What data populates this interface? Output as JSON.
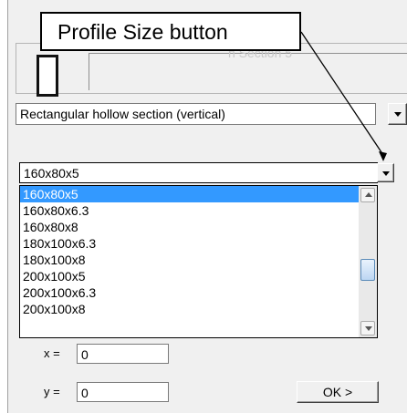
{
  "callout": {
    "text": "Profile Size button"
  },
  "profile_header": {
    "ghost_text": "h Section 5"
  },
  "section_type": {
    "value": "Rectangular hollow section  (vertical)"
  },
  "profile_size": {
    "value": "160x80x5",
    "options": [
      {
        "label": "160x80x5",
        "selected": true
      },
      {
        "label": "160x80x6.3",
        "selected": false
      },
      {
        "label": "160x80x8",
        "selected": false
      },
      {
        "label": "180x100x6.3",
        "selected": false
      },
      {
        "label": "180x100x8",
        "selected": false
      },
      {
        "label": "200x100x5",
        "selected": false
      },
      {
        "label": "200x100x6.3",
        "selected": false
      },
      {
        "label": "200x100x8",
        "selected": false
      }
    ]
  },
  "coords": {
    "x_label": "x =",
    "x_value": "0",
    "y_label": "y =",
    "y_value": "0"
  },
  "ok_button": {
    "label": "OK >"
  },
  "colors": {
    "selection": "#3399ff",
    "panel": "#f0f0f0"
  }
}
